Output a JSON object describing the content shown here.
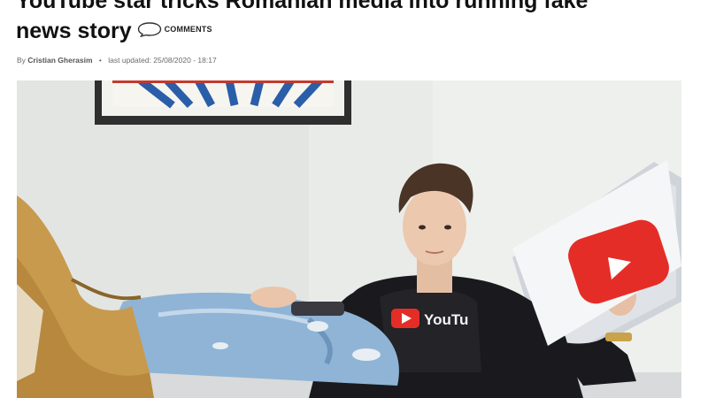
{
  "article": {
    "headline_line1": "YouTube star tricks Romanian media into running fake",
    "headline_line2": "news story",
    "comments_label": "COMMENTS",
    "byline_prefix": "By",
    "author": "Cristian Gherasim",
    "updated_label": "last updated: 25/08/2020 - 18:17"
  },
  "photo": {
    "shirt_logo_text": "YouTu"
  },
  "colors": {
    "youtube_red": "#e52d27",
    "headline": "#111111",
    "meta_text": "#6b6b6b"
  }
}
